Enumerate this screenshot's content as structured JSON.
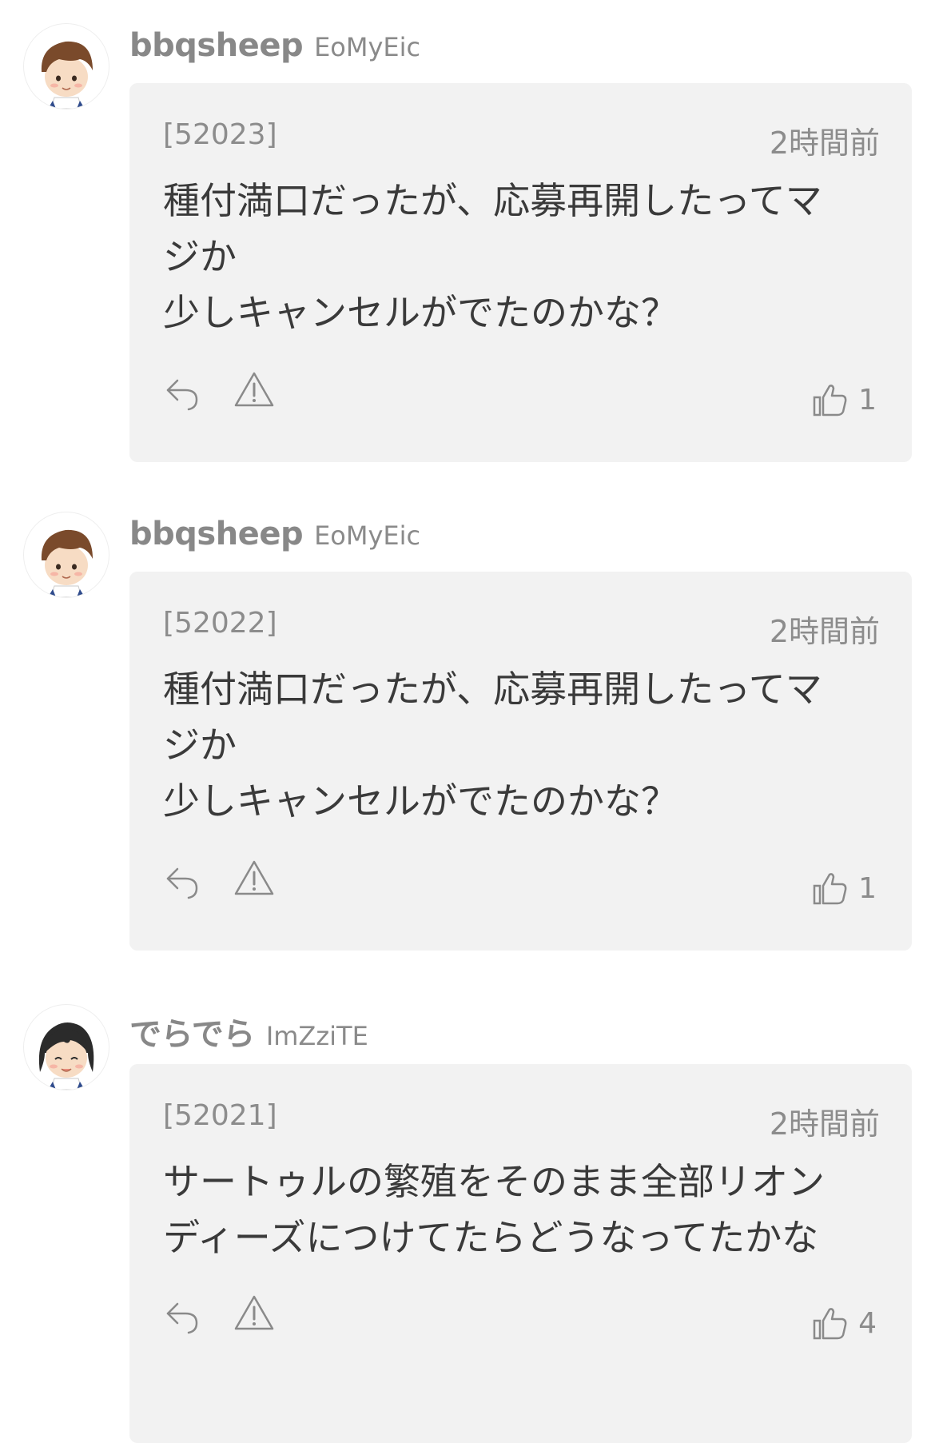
{
  "posts": [
    {
      "user_name": "bbqsheep",
      "user_id": "EoMyEic",
      "number": "[52023]",
      "time": "2時間前",
      "body": [
        "種付満口だったが、応募再開したってマ",
        "ジか",
        "少しキャンセルがでたのかな？"
      ],
      "likes": "1",
      "avatar": "boy-avatar-icon"
    },
    {
      "user_name": "bbqsheep",
      "user_id": "EoMyEic",
      "number": "[52022]",
      "time": "2時間前",
      "body": [
        "種付満口だったが、応募再開したってマ",
        "ジか",
        "少しキャンセルがでたのかな？"
      ],
      "likes": "1",
      "avatar": "boy-avatar-icon"
    },
    {
      "user_name": "でらでら",
      "user_id": "ImZziTE",
      "number": "[52021]",
      "time": "2時間前",
      "body": [
        "サートゥルの繁殖をそのまま全部リオン",
        "ディーズにつけてたらどうなってたかな"
      ],
      "likes": "4",
      "avatar": "girl-avatar-icon"
    }
  ],
  "colors": {
    "card_background": "#f2f2f2",
    "muted_text": "#8c8c8c",
    "body_text": "#3a3a3a",
    "icon_stroke": "#8a8a8a"
  }
}
